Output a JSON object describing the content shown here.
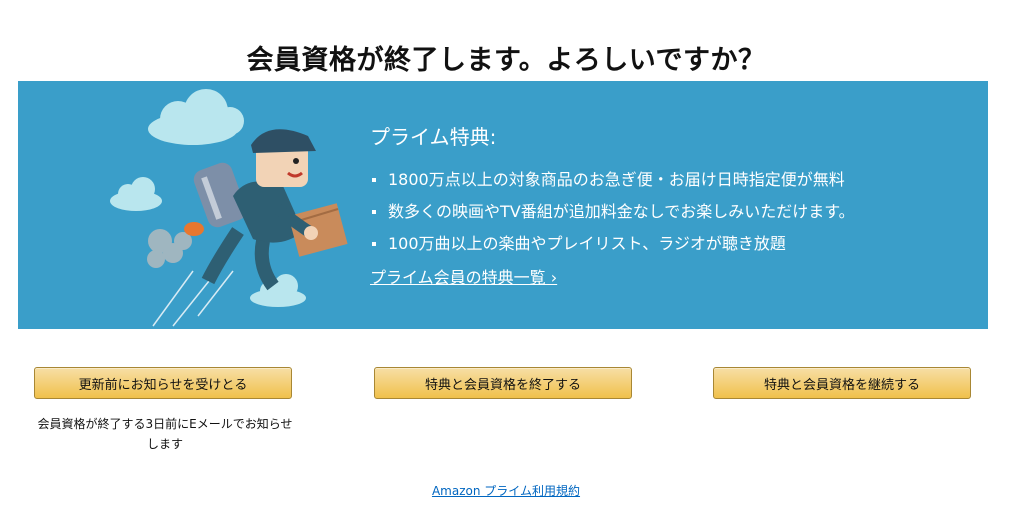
{
  "page": {
    "title": "会員資格が終了します。よろしいですか？"
  },
  "banner": {
    "heading": "プライム特典:",
    "items": [
      "1800万点以上の対象商品のお急ぎ便・お届け日時指定便が無料",
      "数多くの映画やTV番組が追加料金なしでお楽しみいただけます。",
      "100万曲以上の楽曲やプレイリスト、ラジオが聴き放題"
    ],
    "link_label": "プライム会員の特典一覧 ›",
    "background_color": "#3a9ec9"
  },
  "actions": {
    "notify_label": "更新前にお知らせを受けとる",
    "notify_caption": "会員資格が終了する3日前にEメールでお知らせします",
    "end_label": "特典と会員資格を終了する",
    "continue_label": "特典と会員資格を継続する"
  },
  "footer": {
    "terms_label": "Amazon プライム利用規約"
  }
}
